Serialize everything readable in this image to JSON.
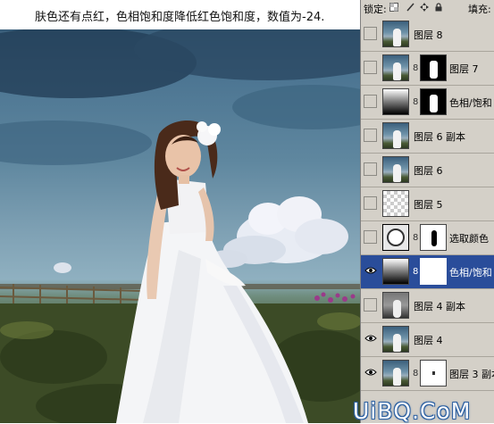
{
  "caption": "肤色还有点红，色相饱和度降低红色饱和度，数值为-24.",
  "panel": {
    "lock_label": "锁定:",
    "fill_label": "填充:",
    "lock_icons": [
      "transparent-lock-icon",
      "brush-lock-icon",
      "move-lock-icon",
      "padlock-icon"
    ]
  },
  "layers": [
    {
      "name": "图层 8",
      "visible": false,
      "thumb": "photo",
      "mask": null,
      "selected": false
    },
    {
      "name": "图层 7",
      "visible": false,
      "thumb": "photo",
      "mask": "black",
      "selected": false
    },
    {
      "name": "色相/饱和",
      "visible": false,
      "thumb": "adjustment",
      "mask": "black",
      "selected": false
    },
    {
      "name": "图层 6 副本",
      "visible": false,
      "thumb": "photo",
      "mask": null,
      "selected": false
    },
    {
      "name": "图层 6",
      "visible": false,
      "thumb": "photo",
      "mask": null,
      "selected": false
    },
    {
      "name": "图层 5",
      "visible": false,
      "thumb": "transparent",
      "mask": null,
      "selected": false
    },
    {
      "name": "选取颜色",
      "visible": false,
      "thumb": "selective-color",
      "mask": "shape",
      "selected": false
    },
    {
      "name": "色相/饱和",
      "visible": true,
      "thumb": "adjustment",
      "mask": "white",
      "selected": true
    },
    {
      "name": "图层 4 副本",
      "visible": false,
      "thumb": "bw",
      "mask": null,
      "selected": false
    },
    {
      "name": "图层 4",
      "visible": true,
      "thumb": "photo",
      "mask": null,
      "selected": false
    },
    {
      "name": "图层 3 副本",
      "visible": true,
      "thumb": "photo",
      "mask": "tiny",
      "selected": false
    }
  ],
  "watermark": "UiBQ.CoM"
}
